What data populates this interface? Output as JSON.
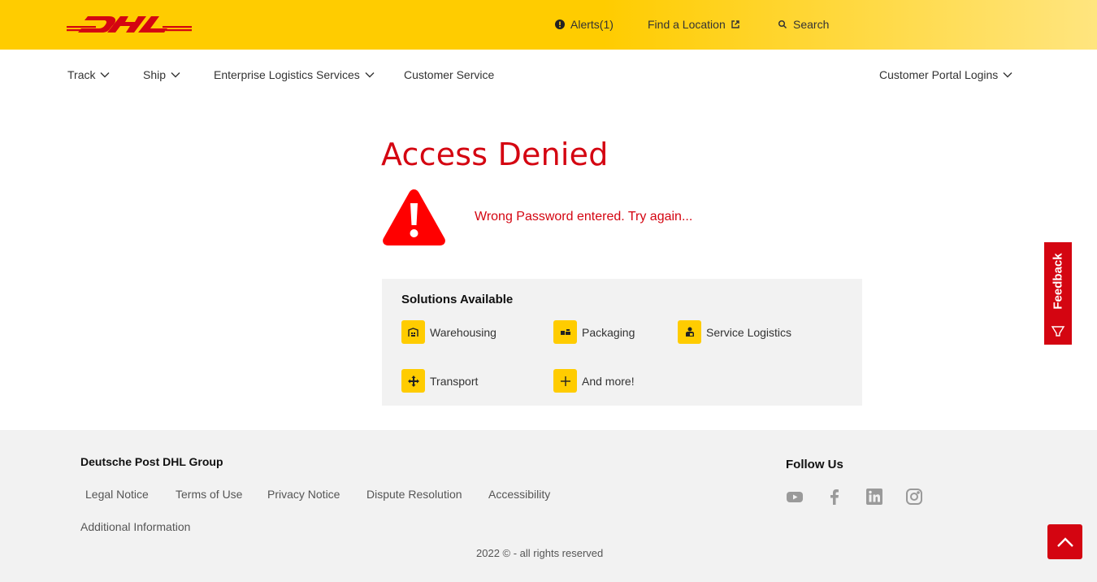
{
  "header": {
    "logo_text": "DHL",
    "alerts_label": "Alerts(1)",
    "find_location_label": "Find a Location",
    "search_label": "Search"
  },
  "nav": {
    "track": "Track",
    "ship": "Ship",
    "enterprise": "Enterprise Logistics Services",
    "customer_service": "Customer Service",
    "portal_logins": "Customer Portal Logins"
  },
  "main": {
    "title": "Access Denied",
    "error_message": "Wrong Password entered. Try again..."
  },
  "solutions": {
    "heading": "Solutions Available",
    "items": [
      {
        "label": "Warehousing",
        "icon": "warehouse-icon"
      },
      {
        "label": "Packaging",
        "icon": "packaging-icon"
      },
      {
        "label": "Service Logistics",
        "icon": "service-logistics-icon"
      },
      {
        "label": "Transport",
        "icon": "transport-icon"
      },
      {
        "label": "And more!",
        "icon": "plus-icon"
      }
    ]
  },
  "feedback": {
    "label": "Feedback"
  },
  "footer": {
    "brand": "Deutsche Post DHL Group",
    "links": [
      "Legal Notice",
      "Terms of Use",
      "Privacy Notice",
      "Dispute Resolution",
      "Accessibility",
      "Additional Information"
    ],
    "follow_title": "Follow Us",
    "social": [
      "youtube-icon",
      "facebook-icon",
      "linkedin-icon",
      "instagram-icon"
    ],
    "copyright": "2022 © - all rights reserved"
  },
  "colors": {
    "dhl_yellow": "#ffcc00",
    "dhl_red": "#d40511",
    "panel_gray": "#f2f2f2"
  }
}
